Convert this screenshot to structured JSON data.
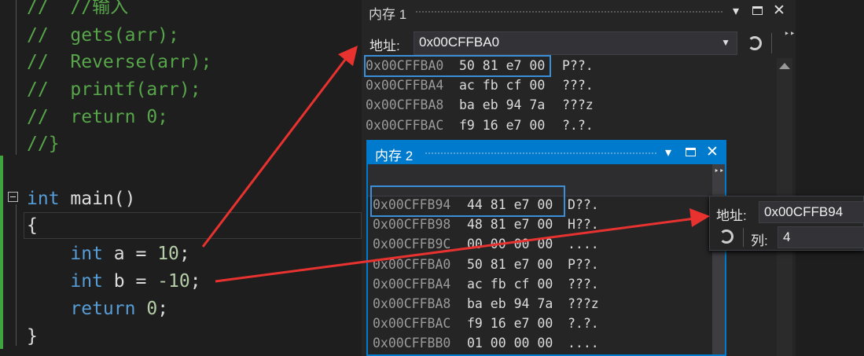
{
  "code_lines": [
    {
      "kind": "comment",
      "text": "//  //输入"
    },
    {
      "kind": "comment",
      "text": "//  gets(arr);"
    },
    {
      "kind": "comment",
      "text": "//  Reverse(arr);"
    },
    {
      "kind": "comment",
      "text": "//  printf(arr);"
    },
    {
      "kind": "comment",
      "text": "//  return 0;"
    },
    {
      "kind": "comment",
      "text": "//}"
    },
    {
      "kind": "code",
      "tokens": [
        {
          "k": "kw",
          "t": "int"
        },
        {
          "k": "pl",
          "t": " main()"
        }
      ]
    },
    {
      "kind": "code",
      "tokens": [
        {
          "k": "pl",
          "t": "{"
        }
      ]
    },
    {
      "kind": "code",
      "tokens": [
        {
          "k": "kw",
          "t": "    int"
        },
        {
          "k": "pl",
          "t": " a = "
        },
        {
          "k": "nm",
          "t": "10"
        },
        {
          "k": "pl",
          "t": ";"
        }
      ]
    },
    {
      "kind": "code",
      "tokens": [
        {
          "k": "kw",
          "t": "    int"
        },
        {
          "k": "pl",
          "t": " b = "
        },
        {
          "k": "nm",
          "t": "-10"
        },
        {
          "k": "pl",
          "t": ";"
        }
      ]
    },
    {
      "kind": "code",
      "tokens": [
        {
          "k": "kw",
          "t": "    return"
        },
        {
          "k": "pl",
          "t": " "
        },
        {
          "k": "nm",
          "t": "0"
        },
        {
          "k": "pl",
          "t": ";"
        }
      ]
    },
    {
      "kind": "code",
      "tokens": [
        {
          "k": "pl",
          "t": "}"
        }
      ]
    }
  ],
  "memory1": {
    "title": "内存 1",
    "address_label": "地址:",
    "address_value": "0x00CFFBA0",
    "rows": [
      {
        "addr": "0x00CFFBA0",
        "bytes": "50 81 e7 00",
        "ascii": "P??."
      },
      {
        "addr": "0x00CFFBA4",
        "bytes": "ac fb cf 00",
        "ascii": "???."
      },
      {
        "addr": "0x00CFFBA8",
        "bytes": "ba eb 94 7a",
        "ascii": "???z"
      },
      {
        "addr": "0x00CFFBAC",
        "bytes": "f9 16 e7 00",
        "ascii": "?.?."
      }
    ]
  },
  "memory2": {
    "title": "内存 2",
    "rows": [
      {
        "addr": "0x00CFFB94",
        "bytes": "44 81 e7 00",
        "ascii": "D??."
      },
      {
        "addr": "0x00CFFB98",
        "bytes": "48 81 e7 00",
        "ascii": "H??."
      },
      {
        "addr": "0x00CFFB9C",
        "bytes": "00 00 00 00",
        "ascii": "...."
      },
      {
        "addr": "0x00CFFBA0",
        "bytes": "50 81 e7 00",
        "ascii": "P??."
      },
      {
        "addr": "0x00CFFBA4",
        "bytes": "ac fb cf 00",
        "ascii": "???."
      },
      {
        "addr": "0x00CFFBA8",
        "bytes": "ba eb 94 7a",
        "ascii": "???z"
      },
      {
        "addr": "0x00CFFBAC",
        "bytes": "f9 16 e7 00",
        "ascii": "?.?."
      },
      {
        "addr": "0x00CFFBB0",
        "bytes": "01 00 00 00",
        "ascii": "...."
      }
    ]
  },
  "popup": {
    "address_label": "地址:",
    "address_value": "0x00CFFB94",
    "columns_label": "列:",
    "columns_value": "4"
  },
  "colors": {
    "highlight": "#3a8fd8",
    "arrow": "#e8322f",
    "title_active": "#007acc"
  }
}
